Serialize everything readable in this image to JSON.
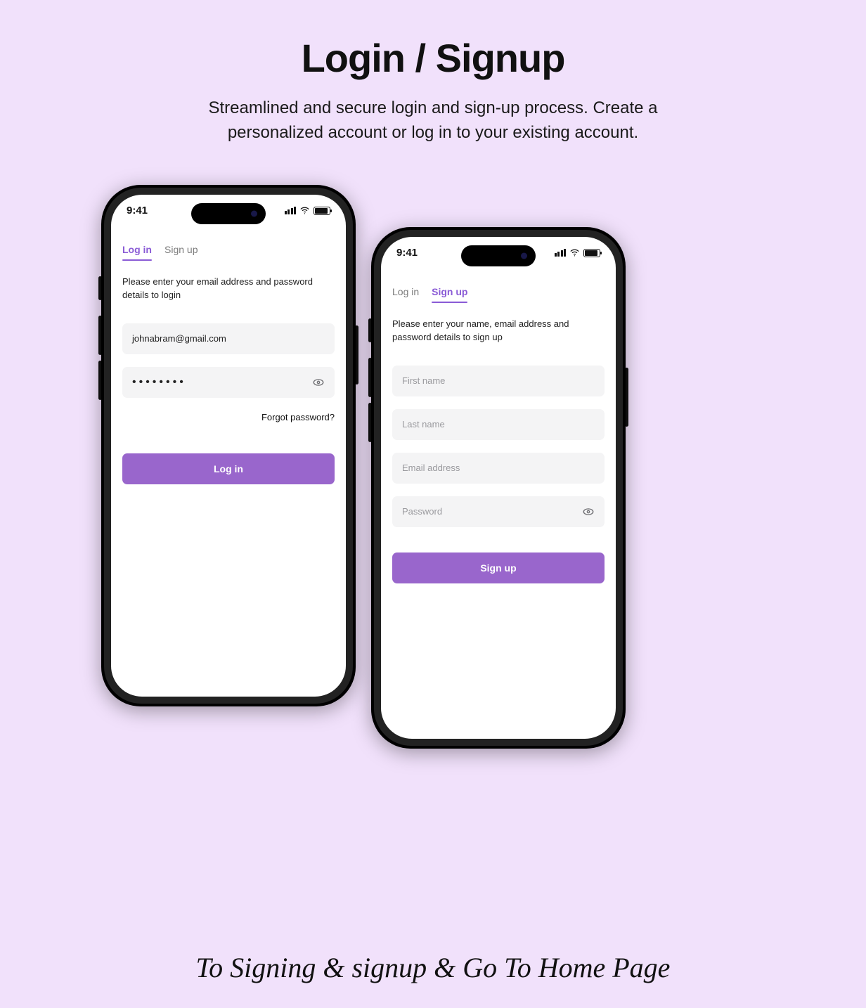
{
  "header": {
    "title": "Login / Signup",
    "subtitle": "Streamlined and secure login and sign-up process. Create a personalized account or log in to your existing account."
  },
  "status": {
    "time": "9:41"
  },
  "login_phone": {
    "tabs": {
      "login": "Log in",
      "signup": "Sign up"
    },
    "instruction": "Please enter your email address and password details to login",
    "email_value": "johnabram@gmail.com",
    "password_mask": "••••••••",
    "forgot": "Forgot password?",
    "submit": "Log in"
  },
  "signup_phone": {
    "tabs": {
      "login": "Log in",
      "signup": "Sign up"
    },
    "instruction": "Please enter your name, email address and password details to sign up",
    "firstname_ph": "First name",
    "lastname_ph": "Last name",
    "email_ph": "Email address",
    "password_ph": "Password",
    "submit": "Sign up"
  },
  "footer": {
    "caption": "To Signing & signup & Go To Home Page"
  },
  "colors": {
    "accent": "#9966cc",
    "bg": "#f1e1fb",
    "field_bg": "#f4f4f5"
  }
}
